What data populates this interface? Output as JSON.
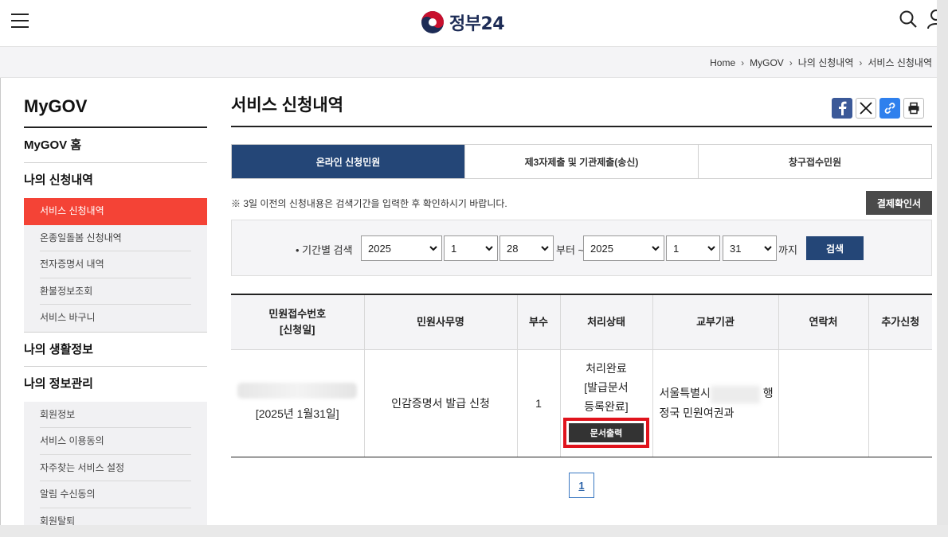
{
  "header": {
    "logo_text": "정부24",
    "menu_icon": "hamburger-menu-icon",
    "search_icon": "search-icon",
    "user_icon": "user-icon"
  },
  "breadcrumb": [
    "Home",
    "MyGOV",
    "나의 신청내역",
    "서비스 신청내역"
  ],
  "sidebar": {
    "title": "MyGOV",
    "sections": [
      {
        "label": "MyGOV 홈"
      },
      {
        "label": "나의 신청내역",
        "items": [
          "서비스 신청내역",
          "온종일돌봄 신청내역",
          "전자증명서 내역",
          "환불정보조회",
          "서비스 바구니"
        ],
        "active": "서비스 신청내역"
      },
      {
        "label": "나의 생활정보"
      },
      {
        "label": "나의 정보관리",
        "items": [
          "회원정보",
          "서비스 이용동의",
          "자주찾는 서비스 설정",
          "알림 수신동의",
          "회원탈퇴"
        ]
      }
    ]
  },
  "main": {
    "title": "서비스 신청내역",
    "share_icons": [
      "facebook-icon",
      "x-icon",
      "link-icon",
      "print-icon"
    ],
    "tabs": [
      {
        "label": "온라인 신청민원",
        "active": true
      },
      {
        "label": "제3자제출 및 기관제출(송신)",
        "active": false
      },
      {
        "label": "창구접수민원",
        "active": false
      }
    ],
    "notice": "※ 3일 이전의 신청내용은 검색기간을 입력한 후 확인하시기 바랍니다.",
    "confirm_button": "결제확인서",
    "search": {
      "label": "• 기간별 검색",
      "from_year": "2025",
      "from_month": "1",
      "from_day": "28",
      "from_text": "부터 ~",
      "to_year": "2025",
      "to_month": "1",
      "to_day": "31",
      "to_text": "까지",
      "button": "검색"
    },
    "table": {
      "headers": [
        "민원접수번호\n[신청일]",
        "민원사무명",
        "부수",
        "처리상태",
        "교부기관",
        "연락처",
        "추가신청"
      ],
      "header_receipt_line1": "민원접수번호",
      "header_receipt_line2": "[신청일]",
      "rows": [
        {
          "date": "[2025년 1월31일]",
          "service": "인감증명서 발급 신청",
          "copies": "1",
          "status_line1": "처리완료",
          "status_line2": "[발급문서",
          "status_line3": "등록완료]",
          "print_button": "문서출력",
          "agency_line1": "서울특별시",
          "agency_line1_tail": "행",
          "agency_line2": "정국 민원여권과",
          "contact": "",
          "extra": ""
        }
      ]
    },
    "pagination": {
      "current": "1"
    }
  },
  "colors": {
    "primary_navy": "#244677",
    "active_red": "#f44336",
    "highlight_red": "#e0131c",
    "dark_button": "#4a4a4a"
  }
}
